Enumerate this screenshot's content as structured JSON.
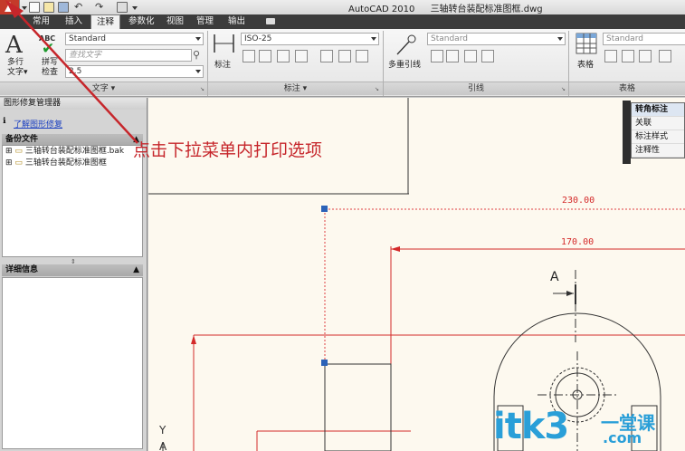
{
  "window": {
    "app_name": "AutoCAD 2010",
    "file_name": "三轴转台装配标准图框.dwg"
  },
  "tabs": [
    {
      "label": "常用"
    },
    {
      "label": "插入"
    },
    {
      "label": "注释"
    },
    {
      "label": "参数化"
    },
    {
      "label": "视图"
    },
    {
      "label": "管理"
    },
    {
      "label": "输出"
    }
  ],
  "ribbon": {
    "text_panel": {
      "footer": "文字 ▾",
      "multiline_label": "多行\n文字",
      "multiline_line1": "多行",
      "multiline_line2": "文字▾",
      "abc_label": "ABC",
      "spellcheck_line1": "拼写",
      "spellcheck_line2": "检查",
      "style_value": "Standard",
      "find_placeholder": "查找文字",
      "height_value": "2.5"
    },
    "dim_panel": {
      "footer": "标注 ▾",
      "dim_label": "标注",
      "style_value": "ISO-25"
    },
    "leader_panel": {
      "footer": "引线",
      "style_value": "Standard",
      "multileader_label": "多重引线"
    },
    "table_panel": {
      "footer": "表格",
      "style_value": "Standard",
      "table_label": "表格"
    }
  },
  "left_panel": {
    "title": "图形修复管理器",
    "link": "了解图形修复",
    "backup_header": "备份文件",
    "files": [
      {
        "name": "三轴转台装配标准图框.bak"
      },
      {
        "name": "三轴转台装配标准图框"
      }
    ],
    "details_header": "详细信息"
  },
  "context_menu": {
    "items": [
      "转角标注",
      "关联",
      "标注样式",
      "注释性"
    ]
  },
  "drawing": {
    "dim_230": "230.00",
    "dim_170": "170.00",
    "section_letter": "A",
    "axis_y": "Y",
    "axis_a": "A"
  },
  "annotation": {
    "text": "点击下拉菜单内打印选项",
    "color": "#c6262b"
  },
  "watermark": {
    "main": "itk3",
    "cn": "一堂课",
    "com": ".com"
  }
}
